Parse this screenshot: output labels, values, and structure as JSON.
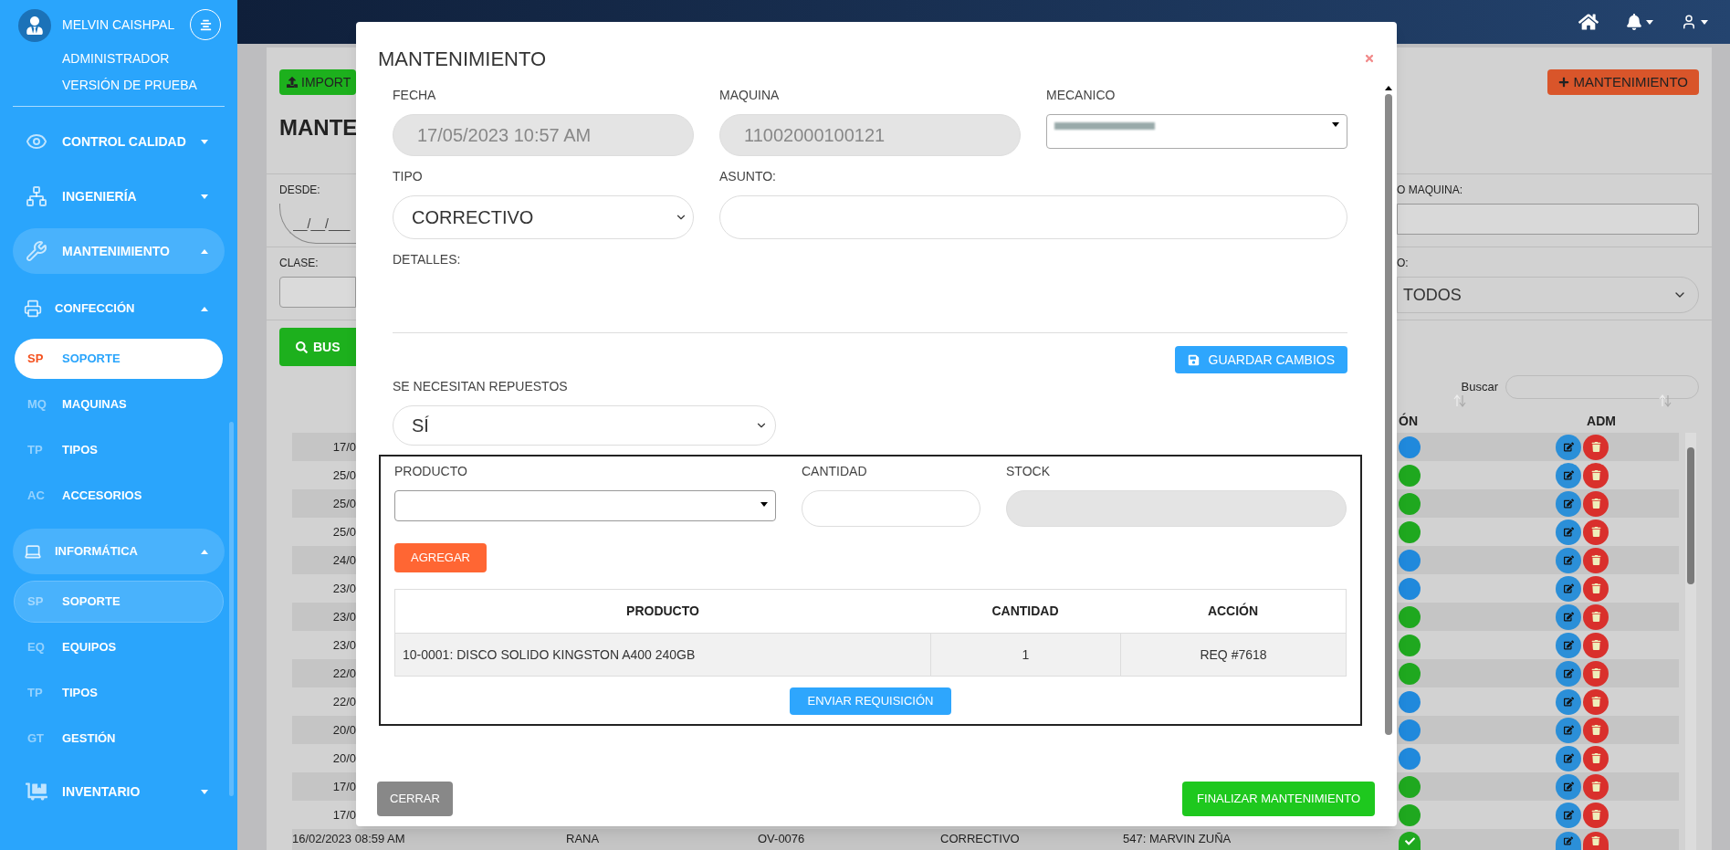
{
  "sidebar": {
    "user": {
      "name": "MELVIN CAISHPAL",
      "role": "ADMINISTRADOR",
      "version": "VERSIÓN DE PRUEBA"
    },
    "menu": [
      {
        "label": "CONTROL CALIDAD",
        "expanded": false,
        "highlighted": false
      },
      {
        "label": "INGENIERÍA",
        "expanded": false,
        "highlighted": false
      },
      {
        "label": "MANTENIMIENTO",
        "expanded": true,
        "highlighted": true,
        "children": [
          {
            "label": "CONFECCIÓN",
            "expanded": true,
            "highlighted": false,
            "children": [
              {
                "abbr": "SP",
                "label": "SOPORTE",
                "selected": true,
                "highlighted": false
              },
              {
                "abbr": "MQ",
                "label": "MAQUINAS",
                "selected": false,
                "highlighted": false
              },
              {
                "abbr": "TP",
                "label": "TIPOS",
                "selected": false,
                "highlighted": false
              },
              {
                "abbr": "AC",
                "label": "ACCESORIOS",
                "selected": false,
                "highlighted": false
              }
            ]
          },
          {
            "label": "INFORMÁTICA",
            "expanded": true,
            "highlighted": true,
            "children": [
              {
                "abbr": "SP",
                "label": "SOPORTE",
                "selected": false,
                "highlighted": true
              },
              {
                "abbr": "EQ",
                "label": "EQUIPOS",
                "selected": false,
                "highlighted": false
              },
              {
                "abbr": "TP",
                "label": "TIPOS",
                "selected": false,
                "highlighted": false
              },
              {
                "abbr": "GT",
                "label": "GESTIÓN",
                "selected": false,
                "highlighted": false
              }
            ]
          }
        ]
      },
      {
        "label": "INVENTARIO",
        "expanded": false,
        "highlighted": false
      }
    ]
  },
  "page": {
    "import_button": "IMPORT",
    "title": "MANTE",
    "add_button": "MANTENIMIENTO",
    "filters_left": [
      {
        "label": "DESDE:",
        "placeholder": "__/__/___"
      },
      {
        "label": "CLASE:"
      }
    ],
    "filters_right": [
      {
        "label": "O MAQUINA:"
      },
      {
        "label": "O:",
        "value": "TODOS"
      }
    ],
    "search_button": "BUS",
    "search_label": "Buscar",
    "columns": [
      "ÓN",
      "ADM"
    ],
    "rows": [
      {
        "date": "17/0",
        "color": "#2089dc"
      },
      {
        "date": "25/0",
        "color": "#1fa81f"
      },
      {
        "date": "25/0",
        "color": "#1fa81f"
      },
      {
        "date": "25/0",
        "color": "#1fa81f"
      },
      {
        "date": "24/0",
        "color": "#2089dc"
      },
      {
        "date": "23/0",
        "color": "#2089dc"
      },
      {
        "date": "23/0",
        "color": "#1fa81f"
      },
      {
        "date": "23/0",
        "color": "#1fa81f"
      },
      {
        "date": "22/0",
        "color": "#1fa81f"
      },
      {
        "date": "22/0",
        "color": "#2089dc"
      },
      {
        "date": "20/0",
        "color": "#2089dc"
      },
      {
        "date": "20/0",
        "color": "#2089dc"
      },
      {
        "date": "17/0",
        "color": "#1fa81f"
      },
      {
        "date": "17/0",
        "color": "#1fa81f"
      }
    ],
    "last_row": {
      "cells": [
        "16/02/2023 08:59 AM",
        "RANA",
        "OV-0076",
        "CORRECTIVO",
        "547: MARVIN ZUÑA"
      ],
      "color": "#1fa81f"
    }
  },
  "modal": {
    "title": "MANTENIMIENTO",
    "fecha": {
      "label": "FECHA",
      "value": "17/05/2023 10:57 AM",
      "disabled": true
    },
    "maquina": {
      "label": "MAQUINA",
      "value": "11002000100121",
      "disabled": true
    },
    "mecanico": {
      "label": "MECANICO",
      "redacted": true
    },
    "tipo": {
      "label": "TIPO",
      "value": "CORRECTIVO"
    },
    "asunto": {
      "label": "ASUNTO:"
    },
    "detalles": {
      "label": "DETALLES:"
    },
    "save_button": "GUARDAR CAMBIOS",
    "repuestos": {
      "label": "SE NECESITAN REPUESTOS",
      "value": "SÍ"
    },
    "parts": {
      "producto_label": "PRODUCTO",
      "cantidad_label": "CANTIDAD",
      "stock_label": "STOCK",
      "stock_disabled": true,
      "add_button": "AGREGAR",
      "columns": [
        "PRODUCTO",
        "CANTIDAD",
        "ACCIÓN"
      ],
      "rows": [
        [
          "10-0001: DISCO SOLIDO KINGSTON A400 240GB",
          "1",
          "REQ #7618"
        ]
      ],
      "send_button": "ENVIAR REQUISICIÓN"
    },
    "close_button": "CERRAR",
    "finish_button": "FINALIZAR MANTENIMIENTO"
  }
}
